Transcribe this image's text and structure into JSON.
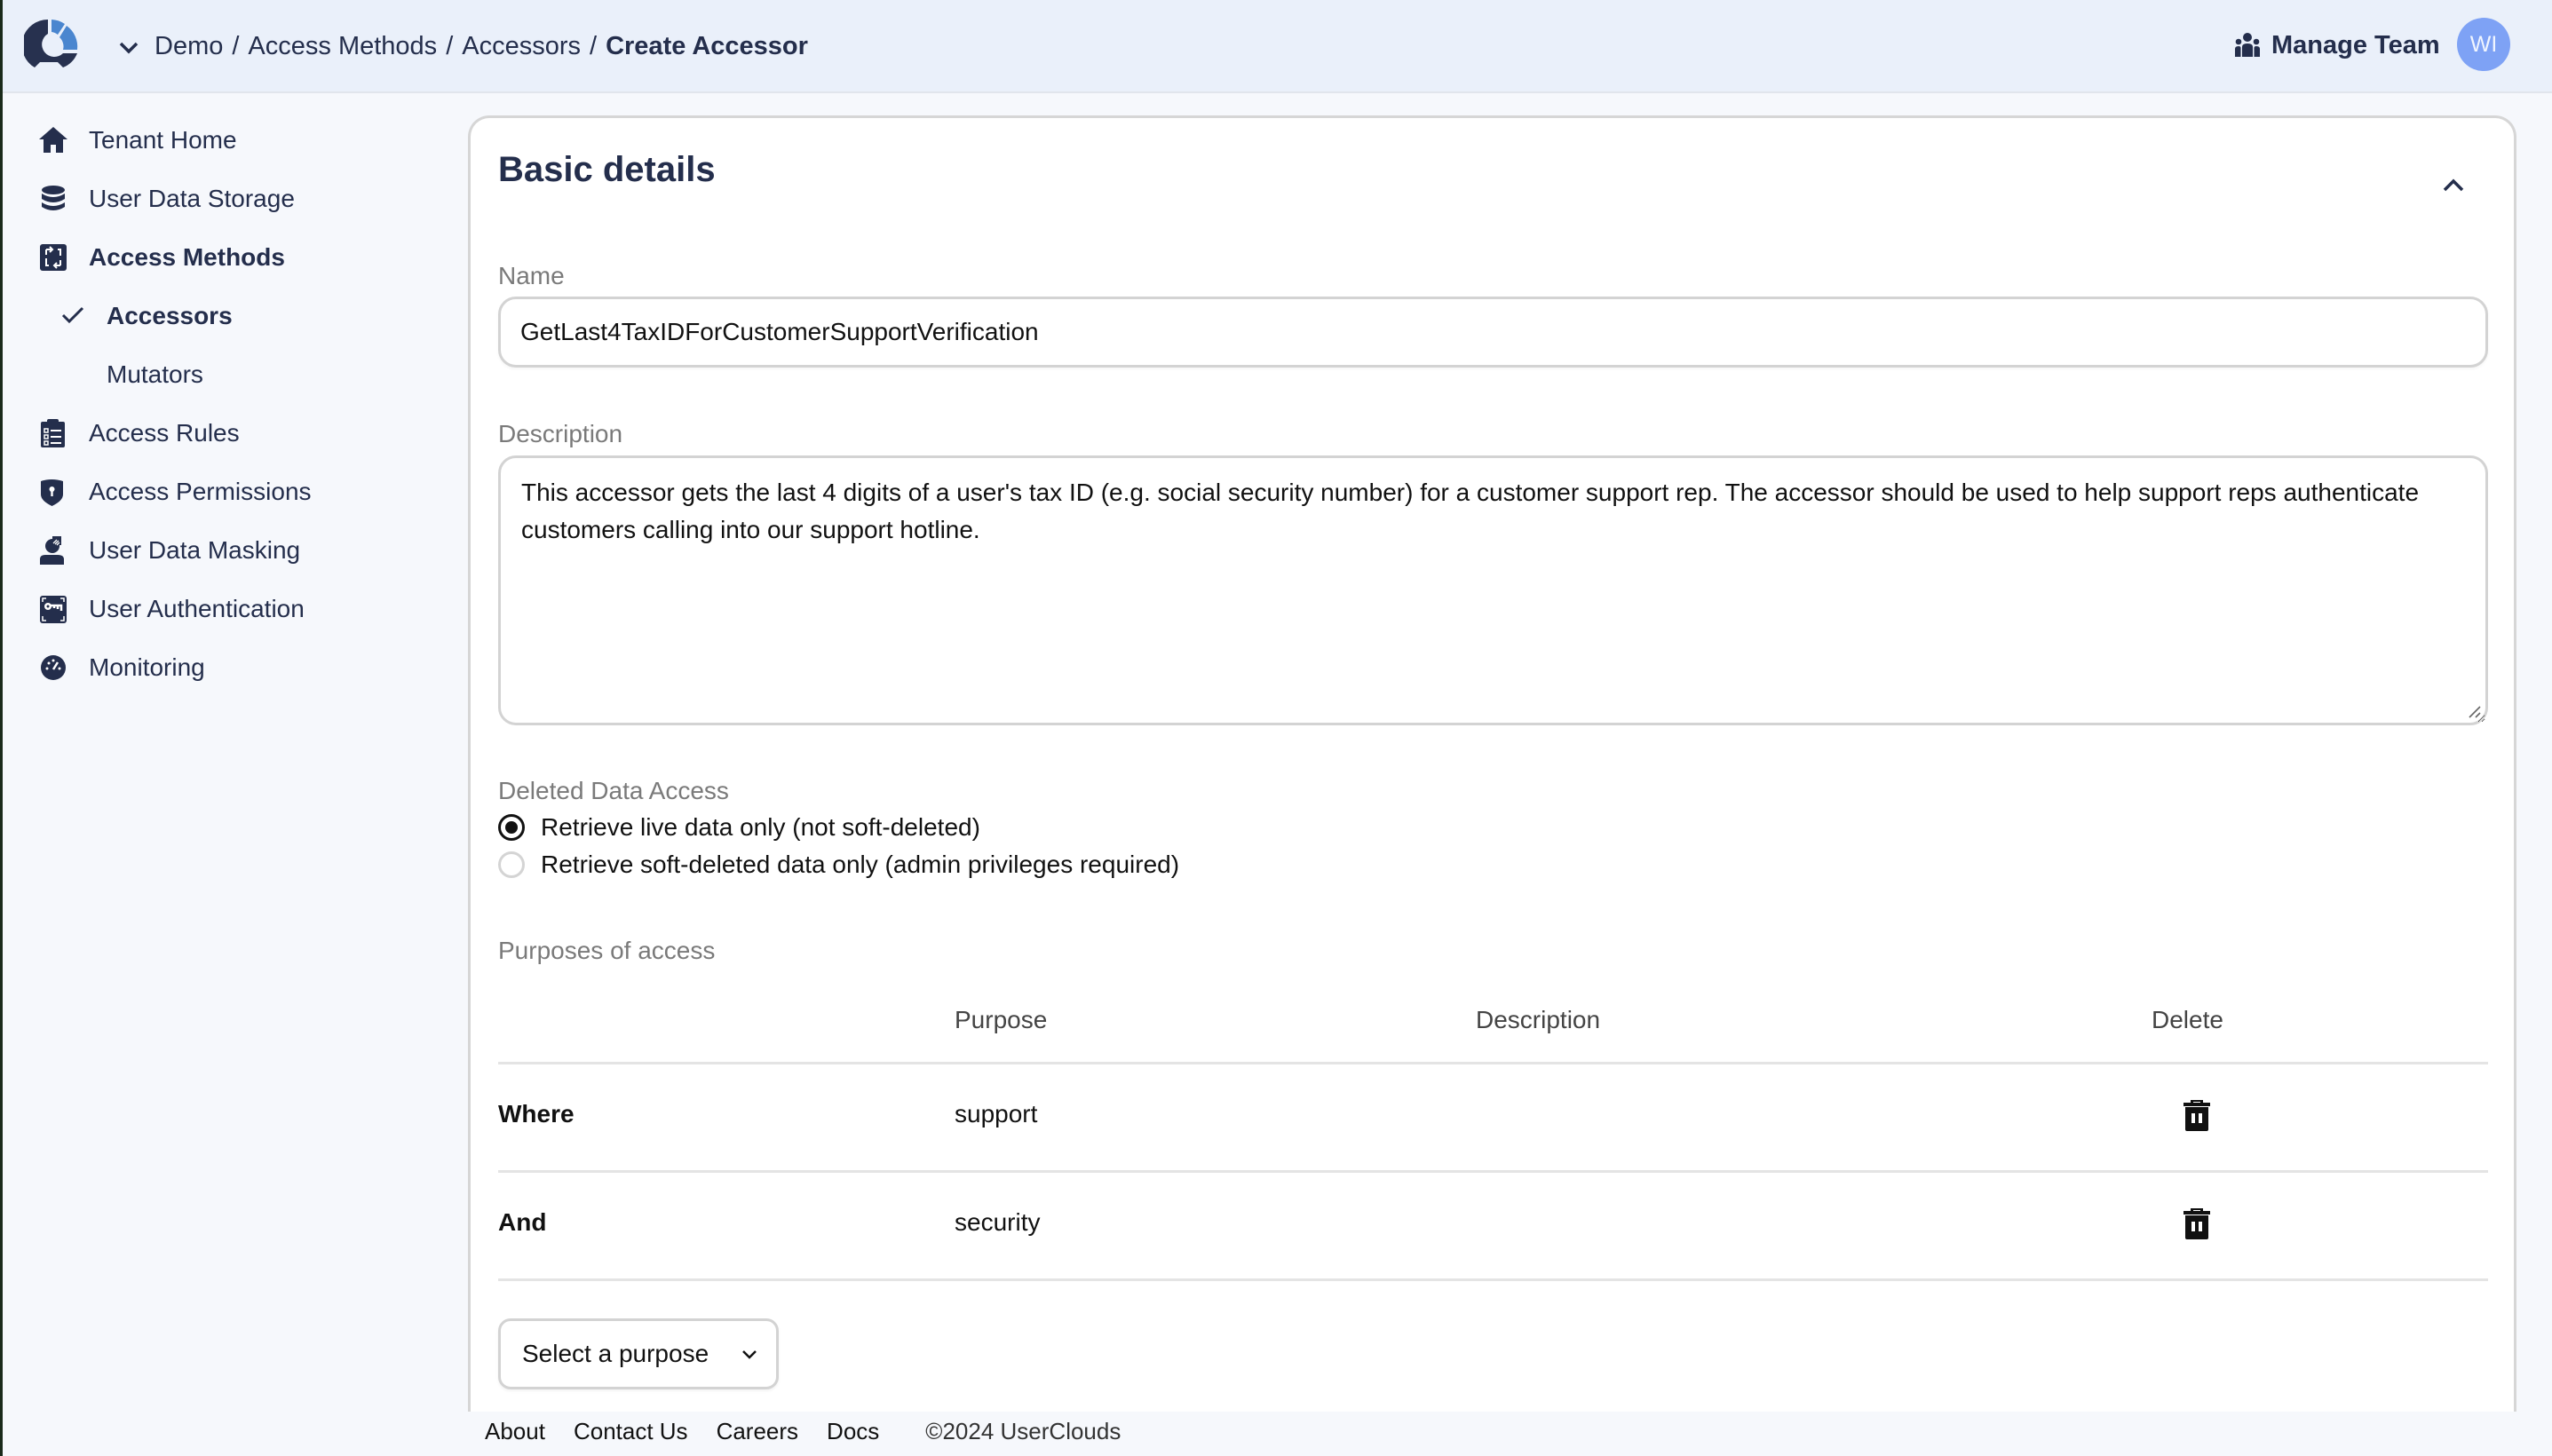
{
  "header": {
    "logo": "usercloud-logo",
    "org_selector_icon": "chevron-down-icon",
    "breadcrumb": [
      {
        "label": "Demo"
      },
      {
        "label": "Access Methods"
      },
      {
        "label": "Accessors"
      },
      {
        "label": "Create Accessor"
      }
    ],
    "breadcrumb_separator": "/",
    "manage_team_label": "Manage Team",
    "manage_team_icon": "people-icon",
    "avatar_initials": "WI",
    "avatar_color": "#7EA2F5"
  },
  "sidebar": {
    "items": [
      {
        "label": "Tenant Home",
        "icon": "home-icon"
      },
      {
        "label": "User Data Storage",
        "icon": "database-icon"
      },
      {
        "label": "Access Methods",
        "icon": "access-methods-icon",
        "active": true
      },
      {
        "label": "Accessors",
        "icon": "check-icon",
        "sub": true,
        "active": true
      },
      {
        "label": "Mutators",
        "sub": true
      },
      {
        "label": "Access Rules",
        "icon": "clipboard-list-icon"
      },
      {
        "label": "Access Permissions",
        "icon": "shield-keyhole-icon"
      },
      {
        "label": "User Data Masking",
        "icon": "user-mask-icon"
      },
      {
        "label": "User Authentication",
        "icon": "key-icon"
      },
      {
        "label": "Monitoring",
        "icon": "gauge-icon"
      }
    ]
  },
  "card": {
    "title": "Basic details",
    "collapse_icon": "chevron-up-icon",
    "name": {
      "label": "Name",
      "value": "GetLast4TaxIDForCustomerSupportVerification"
    },
    "description": {
      "label": "Description",
      "value": "This accessor gets the last 4 digits of a user's tax ID (e.g. social security number) for a customer support rep. The accessor should be used to help support reps authenticate customers calling into our support hotline."
    },
    "deleted_data_access": {
      "label": "Deleted Data Access",
      "options": [
        {
          "label": "Retrieve live data only (not soft-deleted)",
          "checked": true
        },
        {
          "label": "Retrieve soft-deleted data only (admin privileges required)",
          "checked": false
        }
      ]
    },
    "purposes": {
      "label": "Purposes of access",
      "columns": [
        "",
        "Purpose",
        "Description",
        "Delete"
      ],
      "rows": [
        {
          "conjunction": "Where",
          "purpose": "support",
          "description": "",
          "delete_icon": "trash-icon"
        },
        {
          "conjunction": "And",
          "purpose": "security",
          "description": "",
          "delete_icon": "trash-icon"
        }
      ],
      "select_placeholder": "Select a purpose"
    }
  },
  "footer": {
    "links": [
      "About",
      "Contact Us",
      "Careers",
      "Docs"
    ],
    "copyright": "©2024 UserClouds"
  }
}
